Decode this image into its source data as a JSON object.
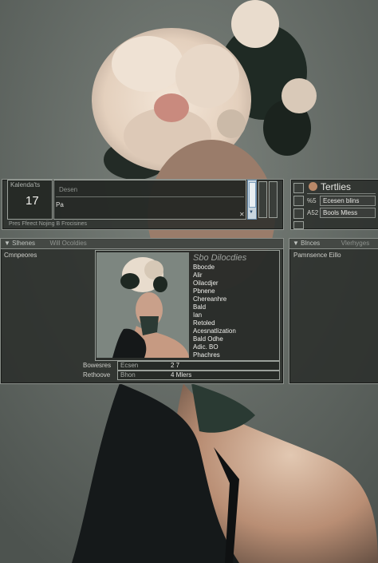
{
  "top_panel": {
    "title": "Kalenda'ts",
    "big_number": "17",
    "field_placeholder": "Desen",
    "field_label": "Pa",
    "status": "Pres Ffeect     Nojing B Frocisines"
  },
  "right_top_panel": {
    "title": "Tertlies",
    "rows": [
      {
        "key": "%5",
        "value": "Ecesen blins"
      },
      {
        "key": "A52",
        "value": "Bools Mless"
      }
    ]
  },
  "main_panel": {
    "tabs": [
      "Slhenes",
      "Will Ocoldies"
    ],
    "sidebar_label": "Cmnpeores",
    "preview_title": "Sbo Dilocdies",
    "list_items": [
      "Bbocde",
      "Alir",
      "Oilacdjer",
      "Pbnene",
      "Chereanhre",
      "Bald",
      "Ian",
      "Retoled",
      "Acesnatlization",
      "Bald Odhe",
      "Adic. BO",
      "Phachres"
    ],
    "footer_rows": [
      {
        "label": "Bowesres",
        "key": "Ecsen",
        "value": "2 7"
      },
      {
        "label": "Rethoove",
        "key": "Bhon",
        "value": "4 Mlers"
      }
    ]
  },
  "right_main_panel": {
    "tabs": [
      "Blnces",
      "Vlerhyges"
    ],
    "label": "Pamnsence Eillo"
  }
}
